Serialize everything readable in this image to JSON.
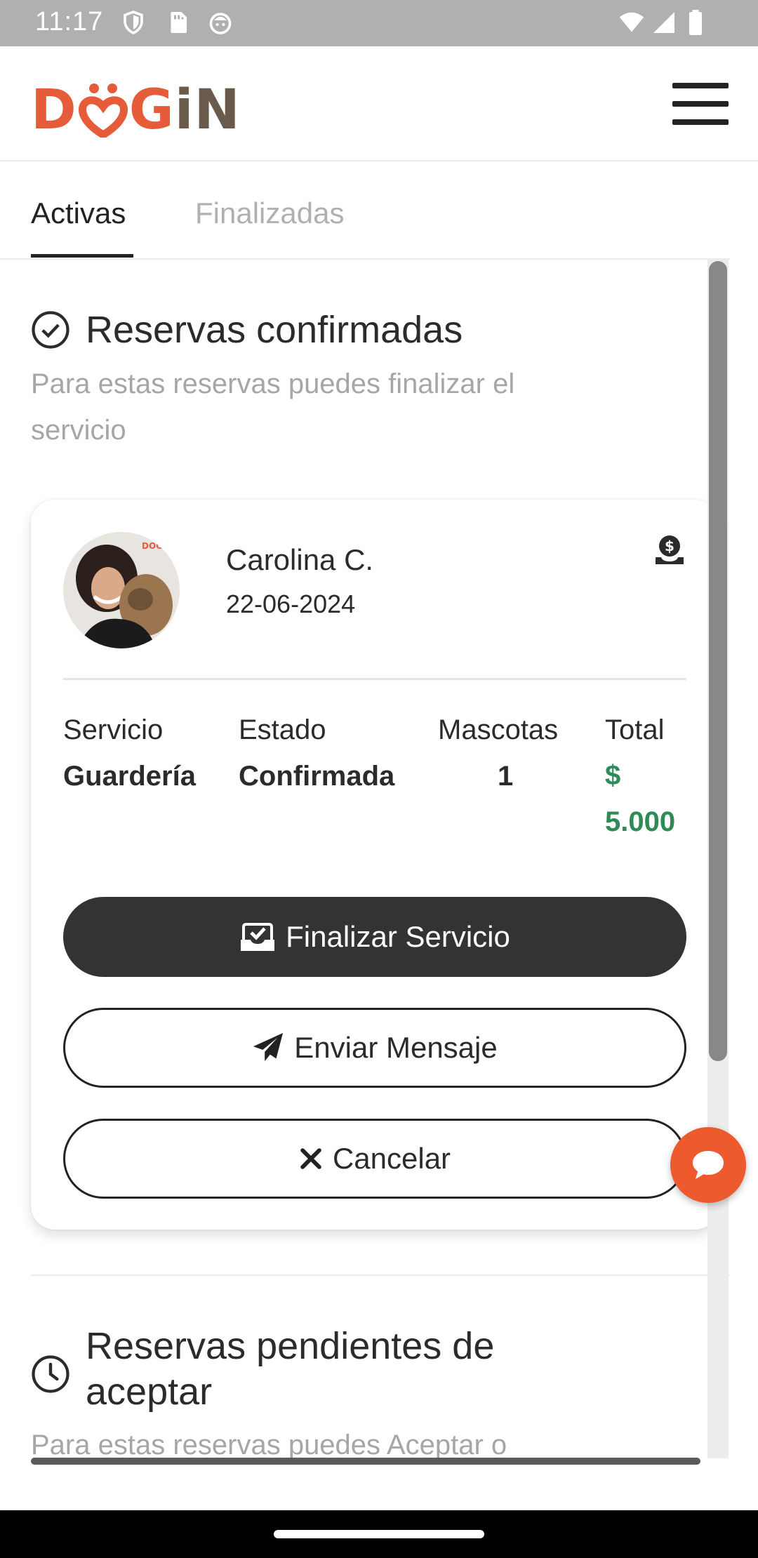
{
  "status_bar": {
    "time": "11:17",
    "icons": [
      "shield-icon",
      "sim-card-icon",
      "face-icon",
      "wifi-icon",
      "signal-icon",
      "battery-icon"
    ]
  },
  "header": {
    "brand": "DOGiN",
    "brand_colors": {
      "primary": "#e65b3a",
      "secondary": "#6a5a4c"
    },
    "menu_icon": "hamburger-menu-icon"
  },
  "tabs": [
    {
      "label": "Activas",
      "active": true
    },
    {
      "label": "Finalizadas",
      "active": false
    }
  ],
  "confirmed_section": {
    "icon": "check-circle-icon",
    "title": "Reservas confirmadas",
    "subtitle": "Para estas reservas puedes finalizar el servicio"
  },
  "reservation": {
    "client_name": "Carolina C.",
    "date": "22-06-2024",
    "payment_icon": "payment-hand-coin-icon",
    "details": {
      "service_label": "Servicio",
      "service_value": "Guardería",
      "status_label": "Estado",
      "status_value": "Confirmada",
      "pets_label": "Mascotas",
      "pets_value": "1",
      "total_label": "Total",
      "total_currency": "$",
      "total_amount": "5.000"
    },
    "actions": {
      "finish": "Finalizar Servicio",
      "message": "Enviar Mensaje",
      "cancel": "Cancelar"
    }
  },
  "pending_section": {
    "icon": "clock-icon",
    "title": "Reservas pendientes de aceptar",
    "subtitle": "Para estas reservas puedes Aceptar o"
  },
  "fab": {
    "icon": "chat-bubble-icon"
  },
  "colors": {
    "accent": "#ec5a2d",
    "total_green": "#2e8b57",
    "dark_button": "#333333",
    "muted_text": "#a6a6a6"
  }
}
